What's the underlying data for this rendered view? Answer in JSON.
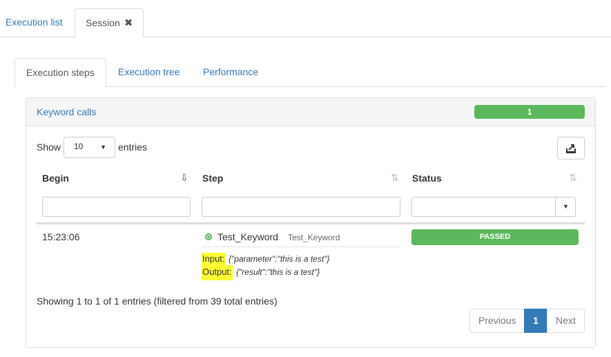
{
  "top_tabs": [
    {
      "label": "Execution list"
    },
    {
      "label": "Session",
      "close_glyph": "✖"
    }
  ],
  "inner_tabs": [
    {
      "label": "Execution steps"
    },
    {
      "label": "Execution tree"
    },
    {
      "label": "Performance"
    }
  ],
  "panel": {
    "title": "Keyword calls",
    "count": "1"
  },
  "length": {
    "show_label": "Show",
    "selected": "10",
    "entries_label": "entries"
  },
  "table": {
    "headers": [
      "Begin",
      "Step",
      "Status"
    ],
    "rows": [
      {
        "begin": "15:23:06",
        "step_name": "Test_Keyword",
        "step_sub": "Test_Keyword",
        "status": "PASSED",
        "input_label": "Input:",
        "input_value": "{\"parameter\":\"this is a test\"}",
        "output_label": "Output:",
        "output_value": "{\"result\":\"this is a test\"}"
      }
    ]
  },
  "info": "Showing 1 to 1 of 1 entries (filtered from 39 total entries)",
  "pagination": {
    "previous": "Previous",
    "current": "1",
    "next": "Next"
  },
  "colors": {
    "link": "#337ab7",
    "success": "#5cb85c",
    "highlight": "#ffff33"
  }
}
